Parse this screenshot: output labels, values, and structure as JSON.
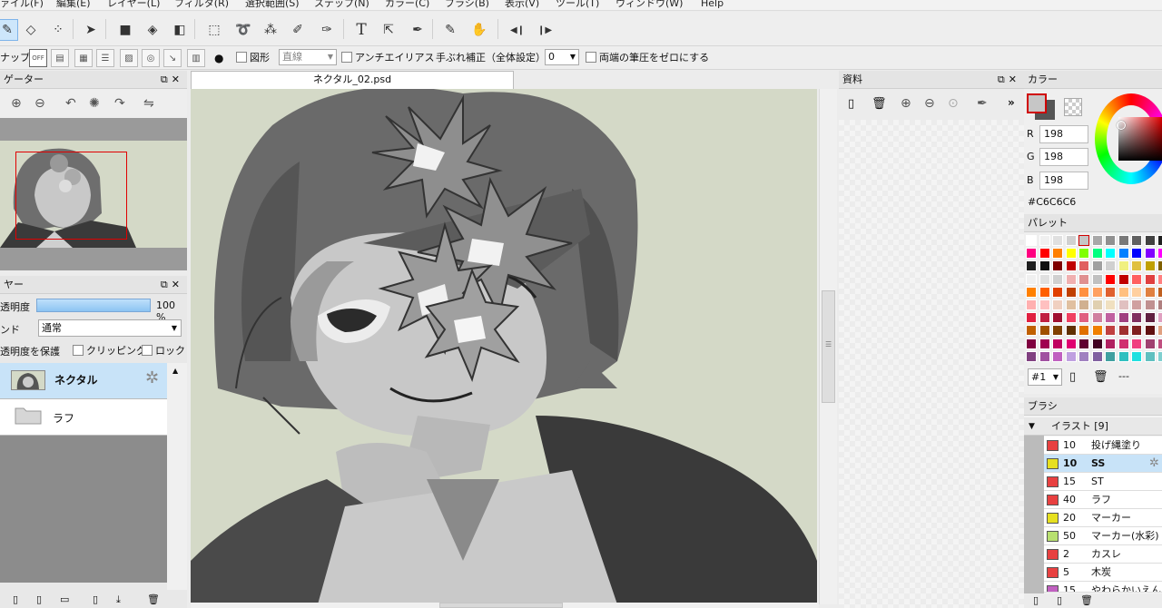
{
  "menubar": [
    "ァイル(F)",
    "編集(E)",
    "レイヤー(L)",
    "フィルタ(R)",
    "選択範囲(S)",
    "ステップ(N)",
    "カラー(C)",
    "ブラシ(B)",
    "表示(V)",
    "ツール(T)",
    "ウィンドウ(W)",
    "Help"
  ],
  "toolbar2": {
    "snap_label": "ナップ",
    "snap_off": "OFF",
    "figure_label": "図形",
    "figure_value": "直線",
    "antialias_label": "アンチエイリアス",
    "stabilizer_label": "手ぶれ補正（全体設定）",
    "stabilizer_value": "0",
    "zero_pressure_label": "両端の筆圧をゼロにする"
  },
  "navigator": {
    "title": "ゲーター"
  },
  "layer": {
    "title": "ヤー",
    "opacity_label": "透明度",
    "opacity_value": "100 %",
    "opacity_fraction": 1.0,
    "blend_label": "ンド",
    "blend_value": "通常",
    "protect_label": "透明度を保護",
    "clipping_label": "クリッピング",
    "lock_label": "ロック",
    "items": [
      {
        "name": "ネクタル",
        "active": true
      },
      {
        "name": "ラフ",
        "active": false
      }
    ]
  },
  "document": {
    "tab": "ネクタル_02.psd"
  },
  "materials": {
    "title": "資料"
  },
  "color": {
    "title": "カラー",
    "r_label": "R",
    "r": "198",
    "g_label": "G",
    "g": "198",
    "b_label": "B",
    "b": "198",
    "hex": "#C6C6C6",
    "current_color": "#C6C6C6"
  },
  "palette": {
    "title": "パレット",
    "set": "#1",
    "dash": "---"
  },
  "brush": {
    "title": "ブラシ",
    "group": "イラスト [9]",
    "items": [
      {
        "size": "10",
        "name": "投げ縄塗り",
        "color": "#e84040",
        "active": false
      },
      {
        "size": "10",
        "name": "SS",
        "color": "#e6e020",
        "active": true
      },
      {
        "size": "15",
        "name": "ST",
        "color": "#e84040",
        "active": false
      },
      {
        "size": "40",
        "name": "ラフ",
        "color": "#e84040",
        "active": false
      },
      {
        "size": "20",
        "name": "マーカー",
        "color": "#e6e020",
        "active": false
      },
      {
        "size": "50",
        "name": "マーカー(水彩)",
        "color": "#b8e070",
        "active": false
      },
      {
        "size": "2",
        "name": "カスレ",
        "color": "#e84040",
        "active": false
      },
      {
        "size": "5",
        "name": "木炭",
        "color": "#e84040",
        "active": false
      },
      {
        "size": "15",
        "name": "やわらかいえんぴ",
        "color": "#c060c0",
        "active": false
      }
    ]
  },
  "icons": [
    "pen-icon",
    "eraser-icon",
    "move-icon",
    "fill-icon",
    "gradient-icon",
    "lasso-icon",
    "magic-wand-icon",
    "text-icon",
    "eyedropper-icon",
    "hand-icon",
    "zoom-in-icon",
    "zoom-out-icon",
    "rotate-icon",
    "flip-icon",
    "trash-icon",
    "gear-icon",
    "folder-icon"
  ]
}
